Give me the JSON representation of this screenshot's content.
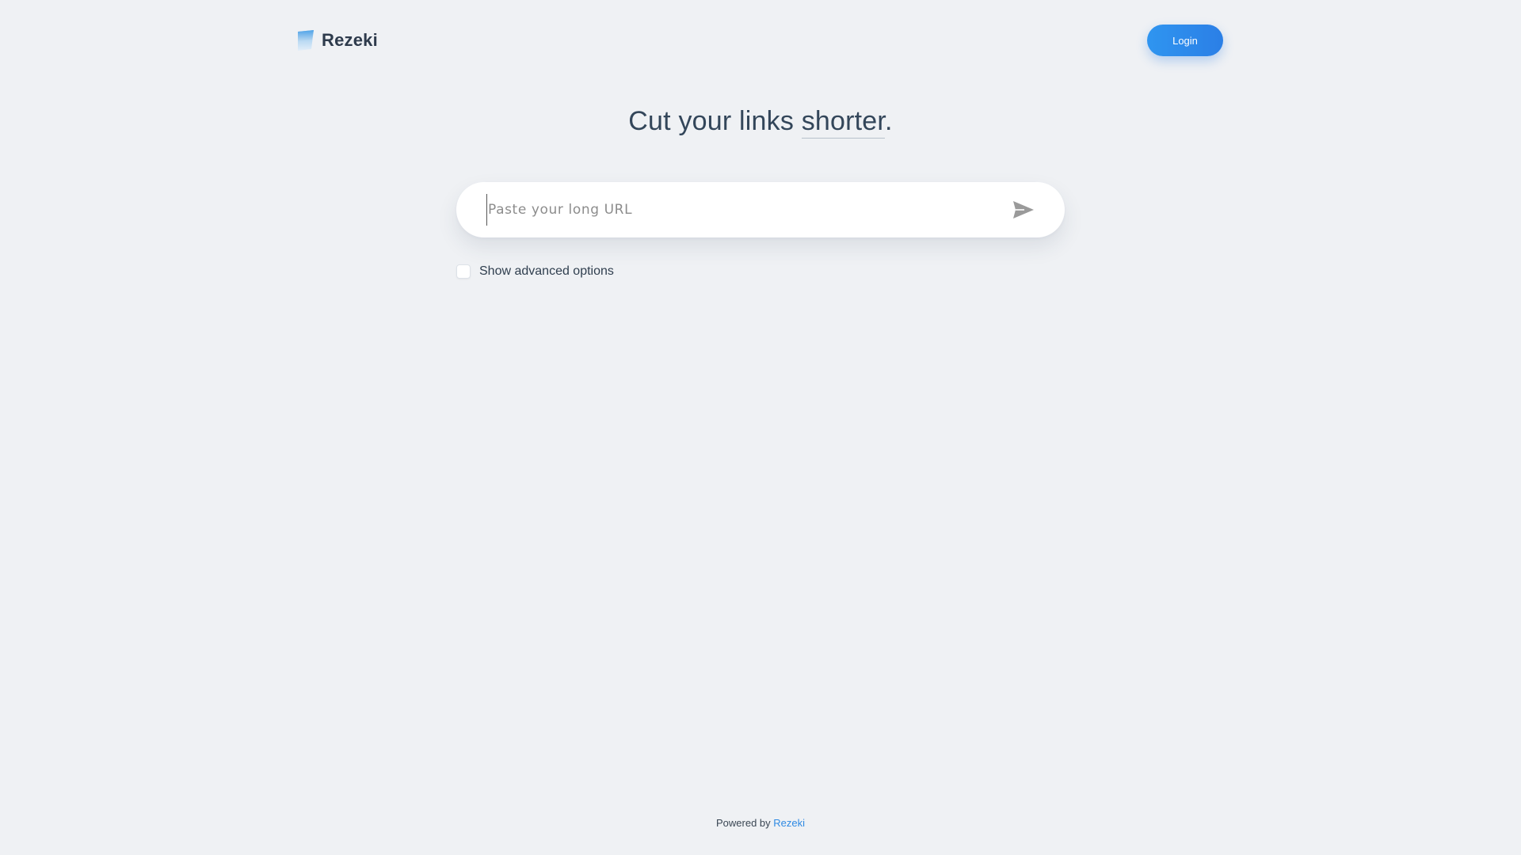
{
  "header": {
    "brand_name": "Rezeki",
    "login_label": "Login"
  },
  "hero": {
    "title_prefix": "Cut your links ",
    "title_accent": "shorter",
    "title_suffix": "."
  },
  "url_form": {
    "placeholder": "Paste your long URL",
    "value": "",
    "submit_icon": "send-icon"
  },
  "advanced": {
    "label": "Show advanced options",
    "checked": false
  },
  "footer": {
    "prefix": "Powered by ",
    "link_text": "Rezeki"
  },
  "colors": {
    "background": "#eff1f4",
    "accent": "#2b7fe6",
    "link": "#2f8ae3",
    "text": "#2e3b4c"
  }
}
